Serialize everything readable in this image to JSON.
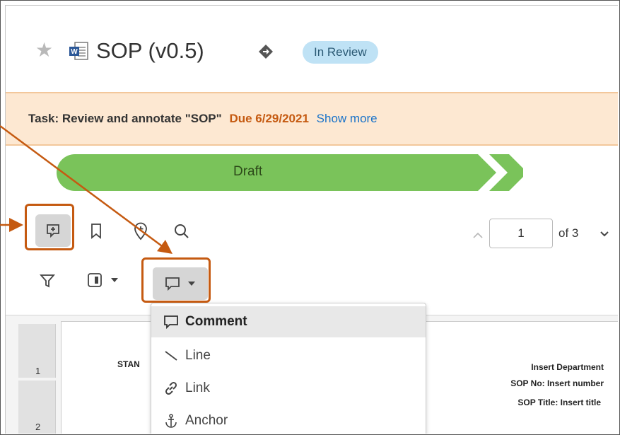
{
  "header": {
    "doc_title": "SOP (v0.5)",
    "status_badge": "In Review"
  },
  "task": {
    "label": "Task: Review and annotate \"SOP\"",
    "due": "Due 6/29/2021",
    "show_more": "Show more"
  },
  "lifecycle": {
    "current_stage": "Draft"
  },
  "pager": {
    "page_value": "1",
    "of_label": "of 3"
  },
  "thumbnails": [
    "1",
    "2"
  ],
  "document": {
    "stan_text": "STAN",
    "department": "Insert Department",
    "sop_no": "SOP No: Insert number",
    "sop_title": "SOP Title: Insert title"
  },
  "annotation_menu": {
    "items": [
      {
        "label": "Comment",
        "icon": "comment-icon"
      },
      {
        "label": "Line",
        "icon": "line-icon"
      },
      {
        "label": "Link",
        "icon": "link-icon"
      },
      {
        "label": "Anchor",
        "icon": "anchor-icon"
      }
    ]
  },
  "colors": {
    "accent": "#c55a11",
    "task_bg": "#fde8d2",
    "stage_green": "#7ac35a",
    "badge_bg": "#bfe2f5",
    "link": "#1a73c9"
  }
}
